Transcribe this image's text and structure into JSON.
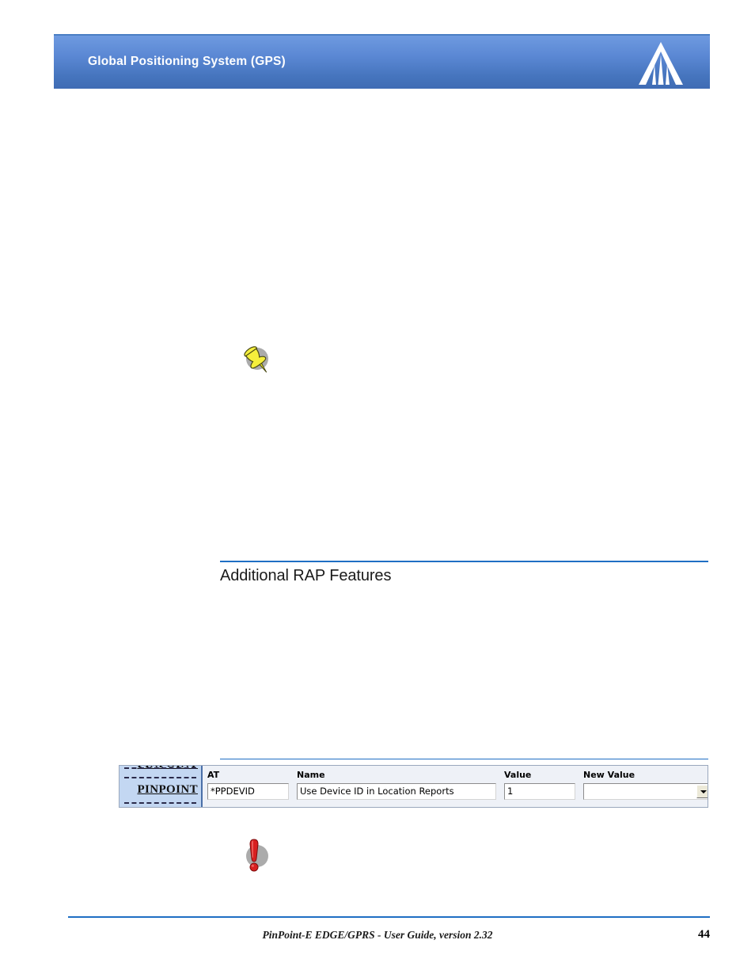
{
  "page": {
    "background_color": "#ffffff",
    "accent_color": "#1f6fc4",
    "header_color": "#5b88d4"
  },
  "header": {
    "title": "Global Positioning System (GPS)",
    "logo_name": "sierra-wireless-logo"
  },
  "note": {
    "icon_name": "pushpin-note-icon",
    "icon_color": "#f2e93a"
  },
  "section": {
    "heading": "Additional RAP Features"
  },
  "figure": {
    "sidebar": {
      "brand": "PINPOINT",
      "brand_ghost": "PINPOINT",
      "background_color": "#c3d7f2"
    },
    "columns": [
      {
        "header": "AT",
        "value": "*PPDEVID"
      },
      {
        "header": "Name",
        "value": "Use Device ID in Location Reports"
      },
      {
        "header": "Value",
        "value": "1"
      },
      {
        "header": "New Value",
        "value": ""
      }
    ]
  },
  "warning": {
    "icon_name": "warning-exclamation-icon",
    "icon_color": "#d81f20"
  },
  "footer": {
    "text": "PinPoint-E EDGE/GPRS - User Guide, version 2.32",
    "page_number": "44"
  }
}
